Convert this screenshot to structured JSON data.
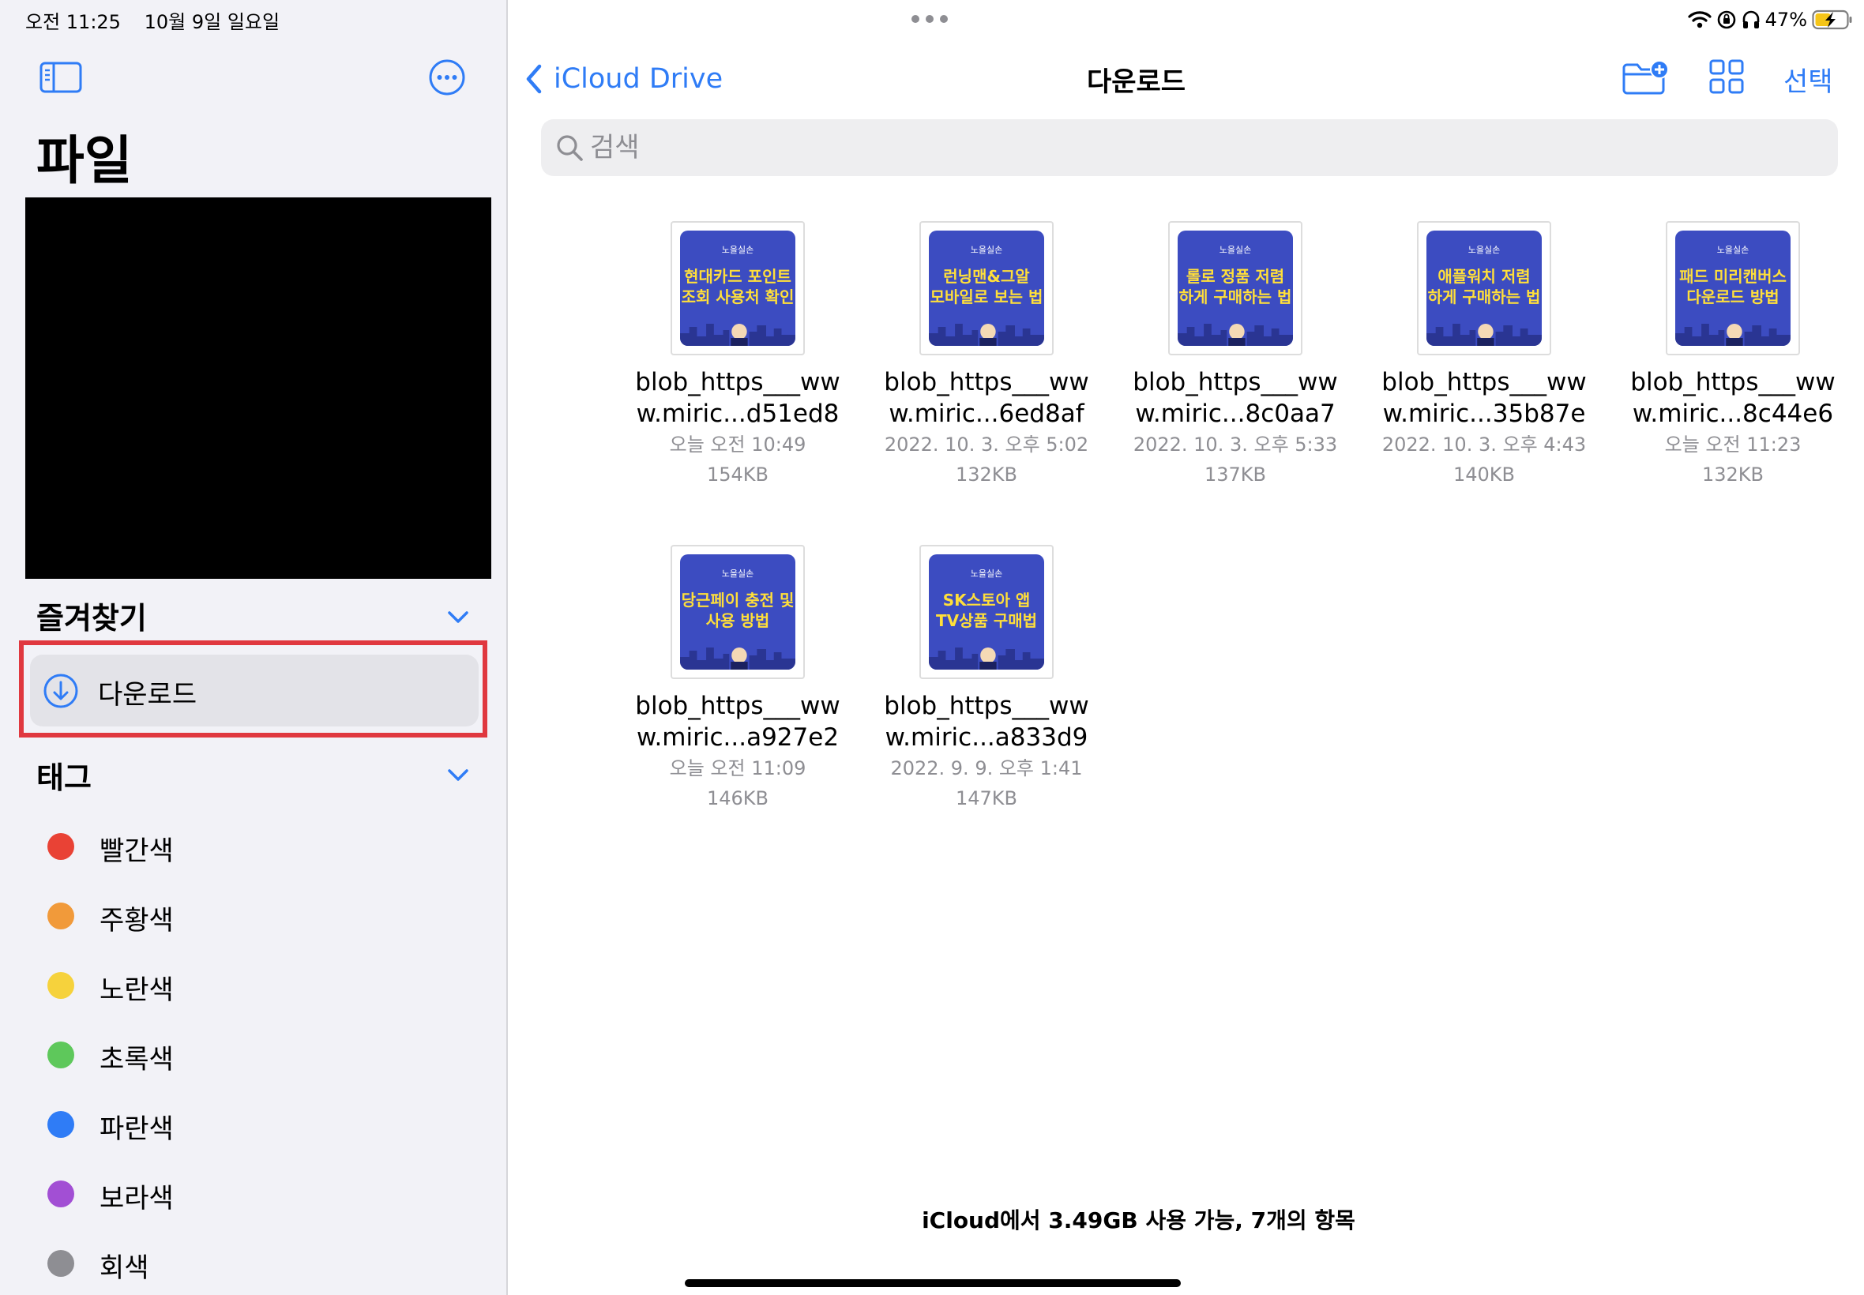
{
  "status": {
    "time": "오전 11:25",
    "date": "10월 9일 일요일",
    "battery": "47%"
  },
  "sidebar": {
    "title": "파일",
    "favorites_header": "즐겨찾기",
    "favorites": [
      {
        "label": "다운로드",
        "icon": "download-circle-icon"
      }
    ],
    "tags_header": "태그",
    "tags": [
      {
        "label": "빨간색",
        "color": "#e94235"
      },
      {
        "label": "주황색",
        "color": "#f19a3a"
      },
      {
        "label": "노란색",
        "color": "#f6d23c"
      },
      {
        "label": "초록색",
        "color": "#5ec85b"
      },
      {
        "label": "파란색",
        "color": "#2f7cf6"
      },
      {
        "label": "보라색",
        "color": "#a24fd4"
      },
      {
        "label": "회색",
        "color": "#8e8e93"
      }
    ]
  },
  "nav": {
    "back_label": "iCloud Drive",
    "title": "다운로드",
    "select_label": "선택"
  },
  "search": {
    "placeholder": "검색",
    "value": ""
  },
  "files": [
    {
      "name_line1": "blob_https___ww",
      "name_line2": "w.miric...d51ed8",
      "date": "오늘 오전 10:49",
      "size": "154KB",
      "thumb_brand": "노을실손",
      "thumb_line1": "현대카드 포인트",
      "thumb_line2": "조회 사용처 확인"
    },
    {
      "name_line1": "blob_https___ww",
      "name_line2": "w.miric...6ed8af",
      "date": "2022. 10. 3. 오후 5:02",
      "size": "132KB",
      "thumb_brand": "노을실손",
      "thumb_line1": "런닝맨&그알",
      "thumb_line2": "모바일로 보는 법"
    },
    {
      "name_line1": "blob_https___ww",
      "name_line2": "w.miric...8c0aa7",
      "date": "2022. 10. 3. 오후 5:33",
      "size": "137KB",
      "thumb_brand": "노을실손",
      "thumb_line1": "롤로 정품 저렴",
      "thumb_line2": "하게 구매하는 법"
    },
    {
      "name_line1": "blob_https___ww",
      "name_line2": "w.miric...35b87e",
      "date": "2022. 10. 3. 오후 4:43",
      "size": "140KB",
      "thumb_brand": "노을실손",
      "thumb_line1": "애플워치 저렴",
      "thumb_line2": "하게 구매하는 법"
    },
    {
      "name_line1": "blob_https___ww",
      "name_line2": "w.miric...8c44e6",
      "date": "오늘 오전 11:23",
      "size": "132KB",
      "thumb_brand": "노을실손",
      "thumb_line1": "패드 미리캔버스",
      "thumb_line2": "다운로드 방법"
    },
    {
      "name_line1": "blob_https___ww",
      "name_line2": "w.miric...a927e2",
      "date": "오늘 오전 11:09",
      "size": "146KB",
      "thumb_brand": "노을실손",
      "thumb_line1": "당근페이 충전 및",
      "thumb_line2": "사용 방법"
    },
    {
      "name_line1": "blob_https___ww",
      "name_line2": "w.miric...a833d9",
      "date": "2022. 9. 9. 오후 1:41",
      "size": "147KB",
      "thumb_brand": "노을실손",
      "thumb_line1": "SK스토아 앱",
      "thumb_line2": "TV상품 구매법"
    }
  ],
  "footer": {
    "text": "iCloud에서 3.49GB 사용 가능, 7개의 항목"
  },
  "colors": {
    "accent": "#2f7cf6",
    "highlight": "#e0383f",
    "thumb_bg": "#3c4cc1",
    "thumb_text": "#ffdf3a"
  }
}
